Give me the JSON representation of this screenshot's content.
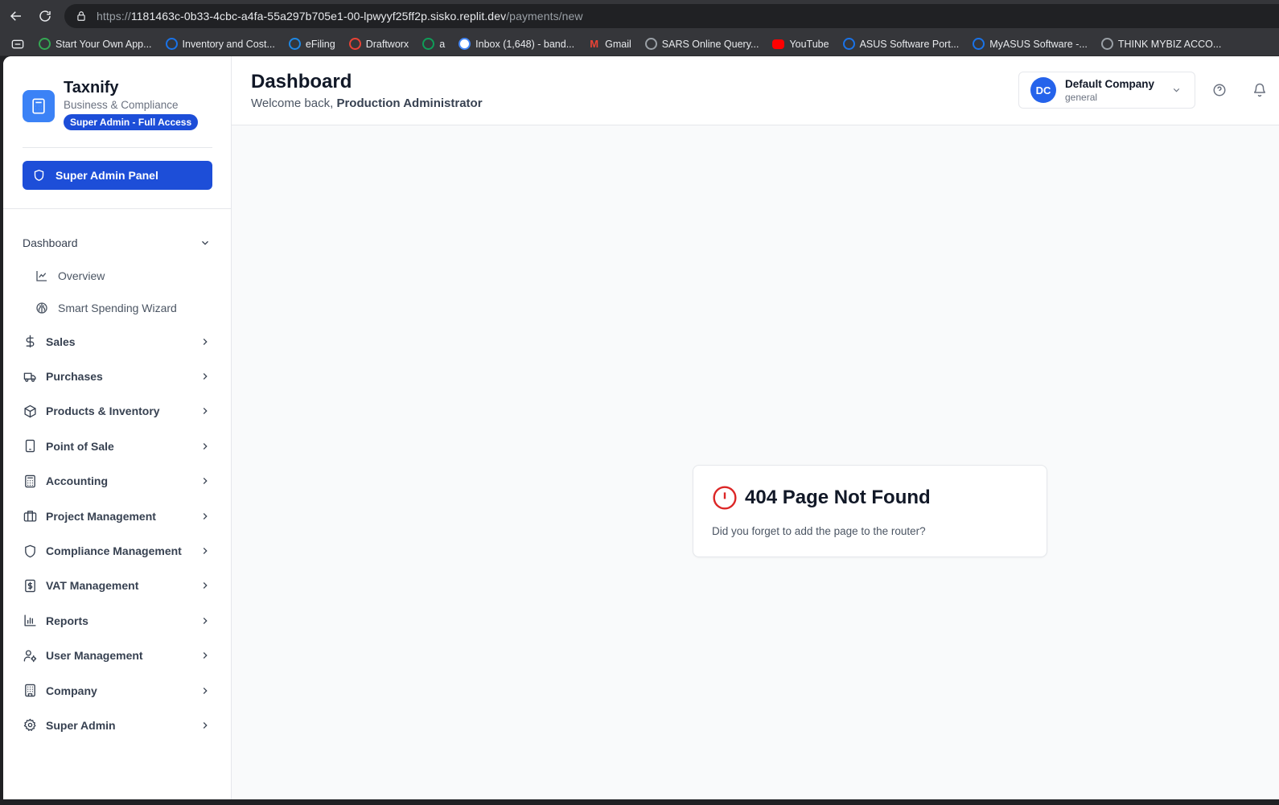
{
  "browser": {
    "url_prefix": "https://",
    "url_host": "1181463c-0b33-4cbc-a4fa-55a297b705e1-00-lpwyyf25ff2p.sisko.replit.dev",
    "url_path": "/payments/new",
    "bookmarks": [
      {
        "label": "Start Your Own App...",
        "icon": "puzzle-icon",
        "color": "#34a853"
      },
      {
        "label": "Inventory and Cost...",
        "icon": "ac-icon",
        "color": "#1a73e8"
      },
      {
        "label": "eFiling",
        "icon": "efiling-icon",
        "color": "#1e88e5"
      },
      {
        "label": "Draftworx",
        "icon": "draftworx-icon",
        "color": "#ea4335"
      },
      {
        "label": "a",
        "icon": "globe-green-icon",
        "color": "#0f9d58"
      },
      {
        "label": "Inbox (1,648) - band...",
        "icon": "google-icon",
        "color": "#ffffff"
      },
      {
        "label": "Gmail",
        "icon": "gmail-icon",
        "color": "#ea4335"
      },
      {
        "label": "SARS Online Query...",
        "icon": "globe-icon",
        "color": "#9aa0a6"
      },
      {
        "label": "YouTube",
        "icon": "youtube-icon",
        "color": "#ff0000"
      },
      {
        "label": "ASUS Software Port...",
        "icon": "asus-icon",
        "color": "#1a73e8"
      },
      {
        "label": "MyASUS Software -...",
        "icon": "asus-icon",
        "color": "#1a73e8"
      },
      {
        "label": "THINK MYBIZ ACCO...",
        "icon": "gear-icon",
        "color": "#9aa0a6"
      }
    ]
  },
  "sidebar": {
    "brand_name": "Taxnify",
    "brand_subtitle": "Business & Compliance",
    "badge": "Super Admin - Full Access",
    "admin_button": "Super Admin Panel",
    "section": "Dashboard",
    "sub_items": [
      {
        "label": "Overview",
        "icon": "line-chart-icon"
      },
      {
        "label": "Smart Spending Wizard",
        "icon": "brain-icon"
      }
    ],
    "items": [
      {
        "label": "Sales",
        "icon": "dollar-icon"
      },
      {
        "label": "Purchases",
        "icon": "truck-icon"
      },
      {
        "label": "Products & Inventory",
        "icon": "package-icon"
      },
      {
        "label": "Point of Sale",
        "icon": "tablet-icon"
      },
      {
        "label": "Accounting",
        "icon": "calculator-icon"
      },
      {
        "label": "Project Management",
        "icon": "briefcase-icon"
      },
      {
        "label": "Compliance Management",
        "icon": "shield-icon"
      },
      {
        "label": "VAT Management",
        "icon": "receipt-icon"
      },
      {
        "label": "Reports",
        "icon": "bar-chart-icon"
      },
      {
        "label": "User Management",
        "icon": "user-cog-icon"
      },
      {
        "label": "Company",
        "icon": "building-icon"
      },
      {
        "label": "Super Admin",
        "icon": "gear-icon"
      }
    ]
  },
  "header": {
    "title": "Dashboard",
    "welcome_prefix": "Welcome back,",
    "user_name": "Production Administrator",
    "company_initials": "DC",
    "company_name": "Default Company",
    "company_type": "general"
  },
  "error": {
    "title": "404 Page Not Found",
    "message": "Did you forget to add the page to the router?"
  },
  "colors": {
    "primary": "#1d4ed8",
    "error": "#dc2626"
  }
}
